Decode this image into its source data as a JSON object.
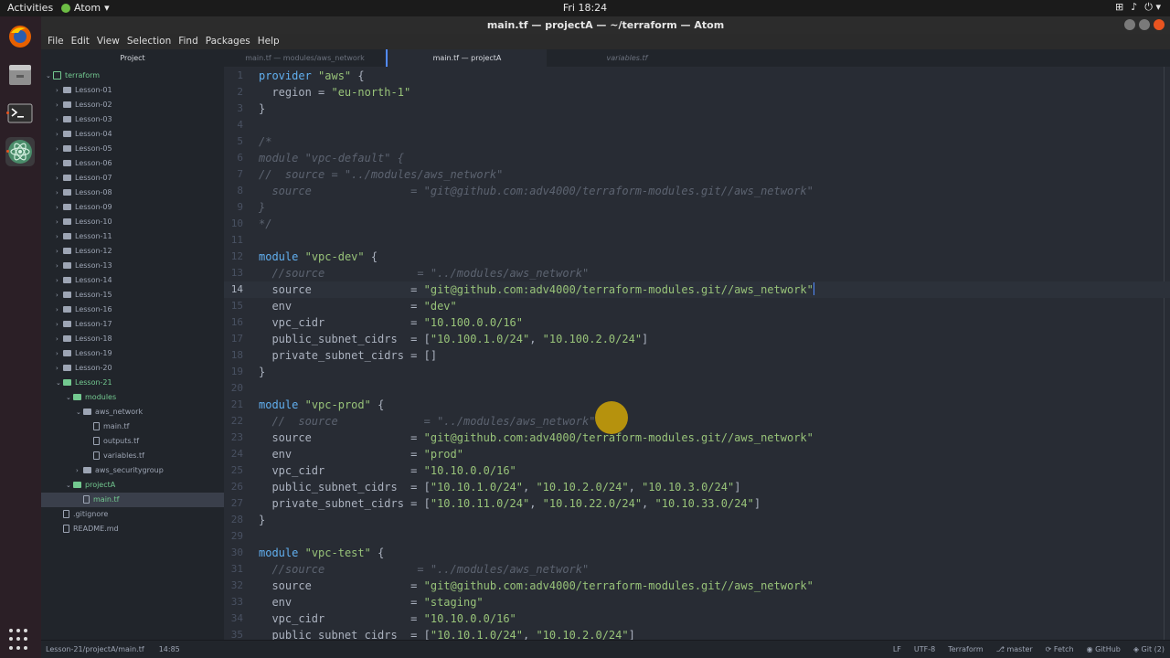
{
  "topbar": {
    "activities": "Activities",
    "app": "Atom",
    "clock": "Fri 18:24",
    "tray": [
      "⊞",
      "♪",
      "⏻ ▾"
    ]
  },
  "window": {
    "title": "main.tf — projectA — ~/terraform — Atom"
  },
  "menu": [
    "File",
    "Edit",
    "View",
    "Selection",
    "Find",
    "Packages",
    "Help"
  ],
  "tabs": {
    "sidebar": "Project",
    "items": [
      {
        "label": "main.tf — modules/aws_network",
        "state": "inactive"
      },
      {
        "label": "main.tf — projectA",
        "state": "active"
      },
      {
        "label": "variables.tf",
        "state": "inactive"
      }
    ]
  },
  "tree": [
    {
      "label": "terraform",
      "type": "repo",
      "expanded": true
    },
    {
      "label": "Lesson-01",
      "type": "folder"
    },
    {
      "label": "Lesson-02",
      "type": "folder"
    },
    {
      "label": "Lesson-03",
      "type": "folder"
    },
    {
      "label": "Lesson-04",
      "type": "folder"
    },
    {
      "label": "Lesson-05",
      "type": "folder"
    },
    {
      "label": "Lesson-06",
      "type": "folder"
    },
    {
      "label": "Lesson-07",
      "type": "folder"
    },
    {
      "label": "Lesson-08",
      "type": "folder"
    },
    {
      "label": "Lesson-09",
      "type": "folder"
    },
    {
      "label": "Lesson-10",
      "type": "folder"
    },
    {
      "label": "Lesson-11",
      "type": "folder"
    },
    {
      "label": "Lesson-12",
      "type": "folder"
    },
    {
      "label": "Lesson-13",
      "type": "folder"
    },
    {
      "label": "Lesson-14",
      "type": "folder"
    },
    {
      "label": "Lesson-15",
      "type": "folder"
    },
    {
      "label": "Lesson-16",
      "type": "folder"
    },
    {
      "label": "Lesson-17",
      "type": "folder"
    },
    {
      "label": "Lesson-18",
      "type": "folder"
    },
    {
      "label": "Lesson-19",
      "type": "folder"
    },
    {
      "label": "Lesson-20",
      "type": "folder"
    },
    {
      "label": "Lesson-21",
      "type": "folder-green",
      "expanded": true
    },
    {
      "label": "modules",
      "type": "folder-green",
      "expanded": true
    },
    {
      "label": "aws_network",
      "type": "folder",
      "expanded": true
    },
    {
      "label": "main.tf",
      "type": "file"
    },
    {
      "label": "outputs.tf",
      "type": "file"
    },
    {
      "label": "variables.tf",
      "type": "file"
    },
    {
      "label": "aws_securitygroup",
      "type": "folder"
    },
    {
      "label": "projectA",
      "type": "folder-green",
      "expanded": true
    },
    {
      "label": "main.tf",
      "type": "file-green",
      "selected": true
    },
    {
      "label": ".gitignore",
      "type": "file"
    },
    {
      "label": "README.md",
      "type": "file"
    }
  ],
  "editor": {
    "cursor_line": 14,
    "lines": [
      [
        [
          "kw",
          "provider"
        ],
        [
          "p",
          " "
        ],
        [
          "str",
          "\"aws\""
        ],
        [
          "p",
          " {"
        ]
      ],
      [
        [
          "p",
          "  region = "
        ],
        [
          "str",
          "\"eu-north-1\""
        ]
      ],
      [
        [
          "p",
          "}"
        ]
      ],
      [],
      [
        [
          "cmt",
          "/*"
        ]
      ],
      [
        [
          "cmt",
          "module \"vpc-default\" {"
        ]
      ],
      [
        [
          "cmt",
          "//  source = \"../modules/aws_network\""
        ]
      ],
      [
        [
          "cmt",
          "  source               = \"git@github.com:adv4000/terraform-modules.git//aws_network\""
        ]
      ],
      [
        [
          "cmt",
          "}"
        ]
      ],
      [
        [
          "cmt",
          "*/"
        ]
      ],
      [],
      [
        [
          "kw",
          "module"
        ],
        [
          "p",
          " "
        ],
        [
          "str",
          "\"vpc-dev\""
        ],
        [
          "p",
          " {"
        ]
      ],
      [
        [
          "cmt",
          "  //source              = \"../modules/aws_network\""
        ]
      ],
      [
        [
          "p",
          "  source               = "
        ],
        [
          "str",
          "\"git@github.com:adv4000/terraform-modules.git//aws_network\""
        ],
        [
          "caret",
          ""
        ]
      ],
      [
        [
          "p",
          "  env                  = "
        ],
        [
          "str",
          "\"dev\""
        ]
      ],
      [
        [
          "p",
          "  vpc_cidr             = "
        ],
        [
          "str",
          "\"10.100.0.0/16\""
        ]
      ],
      [
        [
          "p",
          "  public_subnet_cidrs  = ["
        ],
        [
          "str",
          "\"10.100.1.0/24\""
        ],
        [
          "p",
          ", "
        ],
        [
          "str",
          "\"10.100.2.0/24\""
        ],
        [
          "p",
          "]"
        ]
      ],
      [
        [
          "p",
          "  private_subnet_cidrs = []"
        ]
      ],
      [
        [
          "p",
          "}"
        ]
      ],
      [],
      [
        [
          "kw",
          "module"
        ],
        [
          "p",
          " "
        ],
        [
          "str",
          "\"vpc-prod\""
        ],
        [
          "p",
          " {"
        ]
      ],
      [
        [
          "cmt",
          "  //  source             = \"../modules/aws_network\""
        ]
      ],
      [
        [
          "p",
          "  source               = "
        ],
        [
          "str",
          "\"git@github.com:adv4000/terraform-modules.git//aws_network\""
        ]
      ],
      [
        [
          "p",
          "  env                  = "
        ],
        [
          "str",
          "\"prod\""
        ]
      ],
      [
        [
          "p",
          "  vpc_cidr             = "
        ],
        [
          "str",
          "\"10.10.0.0/16\""
        ]
      ],
      [
        [
          "p",
          "  public_subnet_cidrs  = ["
        ],
        [
          "str",
          "\"10.10.1.0/24\""
        ],
        [
          "p",
          ", "
        ],
        [
          "str",
          "\"10.10.2.0/24\""
        ],
        [
          "p",
          ", "
        ],
        [
          "str",
          "\"10.10.3.0/24\""
        ],
        [
          "p",
          "]"
        ]
      ],
      [
        [
          "p",
          "  private_subnet_cidrs = ["
        ],
        [
          "str",
          "\"10.10.11.0/24\""
        ],
        [
          "p",
          ", "
        ],
        [
          "str",
          "\"10.10.22.0/24\""
        ],
        [
          "p",
          ", "
        ],
        [
          "str",
          "\"10.10.33.0/24\""
        ],
        [
          "p",
          "]"
        ]
      ],
      [
        [
          "p",
          "}"
        ]
      ],
      [],
      [
        [
          "kw",
          "module"
        ],
        [
          "p",
          " "
        ],
        [
          "str",
          "\"vpc-test\""
        ],
        [
          "p",
          " {"
        ]
      ],
      [
        [
          "cmt",
          "  //source              = \"../modules/aws_network\""
        ]
      ],
      [
        [
          "p",
          "  source               = "
        ],
        [
          "str",
          "\"git@github.com:adv4000/terraform-modules.git//aws_network\""
        ]
      ],
      [
        [
          "p",
          "  env                  = "
        ],
        [
          "str",
          "\"staging\""
        ]
      ],
      [
        [
          "p",
          "  vpc_cidr             = "
        ],
        [
          "str",
          "\"10.10.0.0/16\""
        ]
      ],
      [
        [
          "p",
          "  public_subnet_cidrs  = ["
        ],
        [
          "str",
          "\"10.10.1.0/24\""
        ],
        [
          "p",
          ", "
        ],
        [
          "str",
          "\"10.10.2.0/24\""
        ],
        [
          "p",
          "]"
        ]
      ]
    ]
  },
  "status": {
    "path": "Lesson-21/projectA/main.tf",
    "position": "14:85",
    "right": [
      "LF",
      "UTF-8",
      "Terraform",
      "⎇ master",
      "⟳ Fetch",
      "◉ GitHub",
      "◈ Git (2)"
    ]
  }
}
